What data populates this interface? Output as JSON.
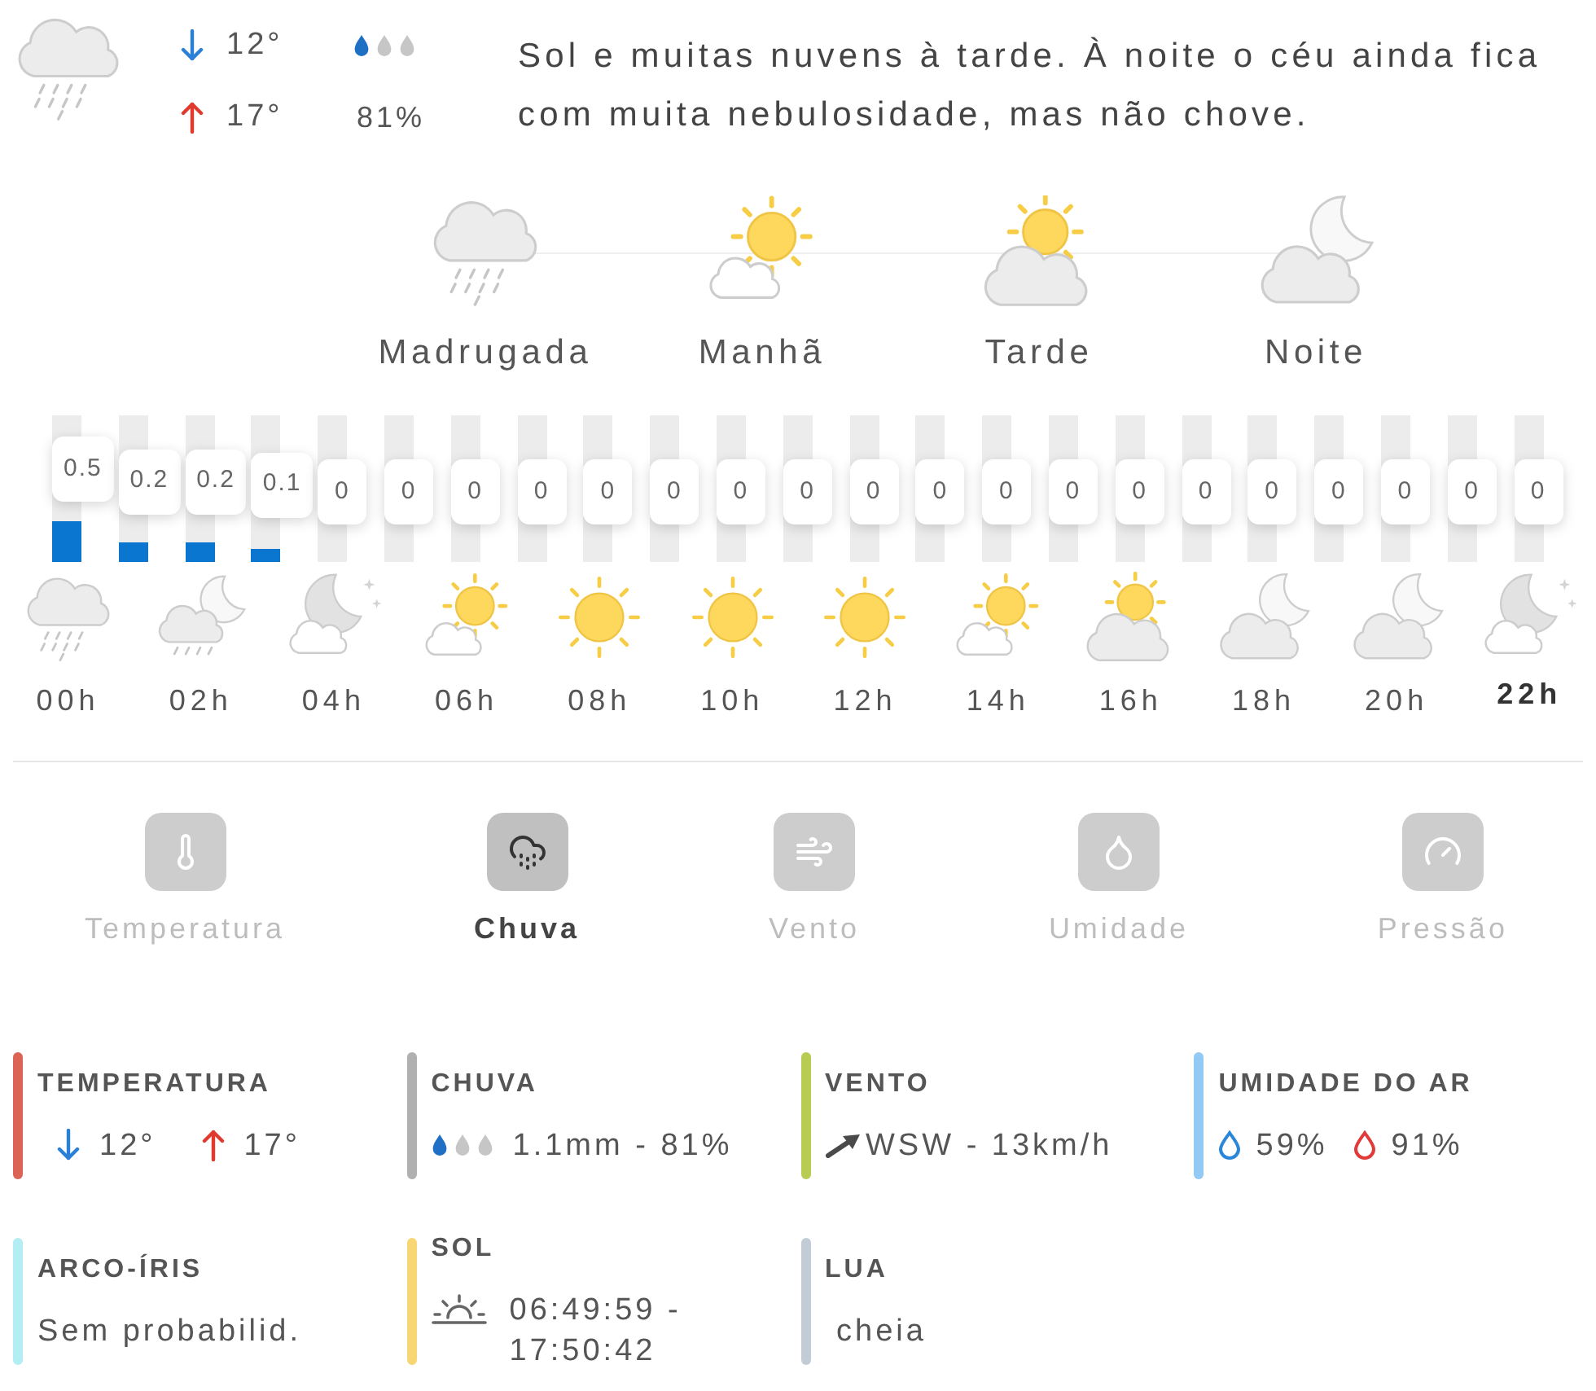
{
  "summary": {
    "kind": "rain",
    "min_temp": "12°",
    "max_temp": "17°",
    "rain_drops": [
      {
        "filled": true
      },
      {
        "filled": false
      },
      {
        "filled": false
      }
    ],
    "rain_chance": "81%",
    "description": "Sol e muitas nuvens à tarde. À noite o céu ainda fica com muita nebulosidade, mas não chove."
  },
  "periods": [
    {
      "label": "Madrugada",
      "kind": "rain"
    },
    {
      "label": "Manhã",
      "kind": "sun-cloud"
    },
    {
      "label": "Tarde",
      "kind": "sun-big-cloud"
    },
    {
      "label": "Noite",
      "kind": "night-cloud"
    }
  ],
  "rain_by_hour": [
    {
      "amount": "0.5",
      "level": 0.28
    },
    {
      "amount": "0.2",
      "level": 0.13
    },
    {
      "amount": "0.2",
      "level": 0.13
    },
    {
      "amount": "0.1",
      "level": 0.09
    },
    {
      "amount": "0"
    },
    {
      "amount": "0"
    },
    {
      "amount": "0"
    },
    {
      "amount": "0"
    },
    {
      "amount": "0"
    },
    {
      "amount": "0"
    },
    {
      "amount": "0"
    },
    {
      "amount": "0"
    },
    {
      "amount": "0"
    },
    {
      "amount": "0"
    },
    {
      "amount": "0"
    },
    {
      "amount": "0"
    },
    {
      "amount": "0"
    },
    {
      "amount": "0"
    },
    {
      "amount": "0"
    },
    {
      "amount": "0"
    },
    {
      "amount": "0"
    },
    {
      "amount": "0"
    },
    {
      "amount": "0"
    }
  ],
  "hours": [
    {
      "label": "00h",
      "kind": "rain",
      "highlighted": false
    },
    {
      "label": "02h",
      "kind": "night-rain",
      "highlighted": false
    },
    {
      "label": "04h",
      "kind": "night-clear-cloud",
      "highlighted": false
    },
    {
      "label": "06h",
      "kind": "sun-cloud",
      "highlighted": false
    },
    {
      "label": "08h",
      "kind": "sun",
      "highlighted": false
    },
    {
      "label": "10h",
      "kind": "sun",
      "highlighted": false
    },
    {
      "label": "12h",
      "kind": "sun",
      "highlighted": false
    },
    {
      "label": "14h",
      "kind": "sun-cloud",
      "highlighted": false
    },
    {
      "label": "16h",
      "kind": "sun-big-cloud",
      "highlighted": false
    },
    {
      "label": "18h",
      "kind": "night-cloud",
      "highlighted": false
    },
    {
      "label": "20h",
      "kind": "night-cloud",
      "highlighted": false
    },
    {
      "label": "22h",
      "kind": "night-clear-cloud",
      "highlighted": true
    }
  ],
  "tabs": [
    {
      "label": "Temperatura",
      "kind": "thermometer",
      "selected": false
    },
    {
      "label": "Chuva",
      "kind": "rain",
      "selected": true
    },
    {
      "label": "Vento",
      "kind": "wind",
      "selected": false
    },
    {
      "label": "Umidade",
      "kind": "humidity",
      "selected": false
    },
    {
      "label": "Pressão",
      "kind": "pressure",
      "selected": false
    }
  ],
  "details": [
    {
      "kind": "temperature",
      "title": "TEMPERATURA",
      "color": "#dc6456",
      "min": "12°",
      "max": "17°"
    },
    {
      "kind": "rain",
      "title": "CHUVA",
      "color": "#b0b0b0",
      "drops": [
        {
          "filled": true
        },
        {
          "filled": false
        },
        {
          "filled": false
        }
      ],
      "value": "1.1mm - 81%"
    },
    {
      "kind": "wind",
      "title": "VENTO",
      "color": "#b8cc52",
      "value": "WSW - 13km/h"
    },
    {
      "kind": "humidity",
      "title": "UMIDADE DO AR",
      "color": "#93c9f3",
      "min": "59%",
      "max": "91%"
    },
    {
      "kind": "text",
      "title": "ARCO-ÍRIS",
      "color": "#b2eef3",
      "value": "Sem probabilid."
    },
    {
      "kind": "sun",
      "title": "SOL",
      "color": "#f8d674",
      "value": "06:49:59 - 17:50:42"
    },
    {
      "kind": "moon",
      "title": "LUA",
      "color": "#c2ccd6",
      "value": "cheia"
    }
  ]
}
